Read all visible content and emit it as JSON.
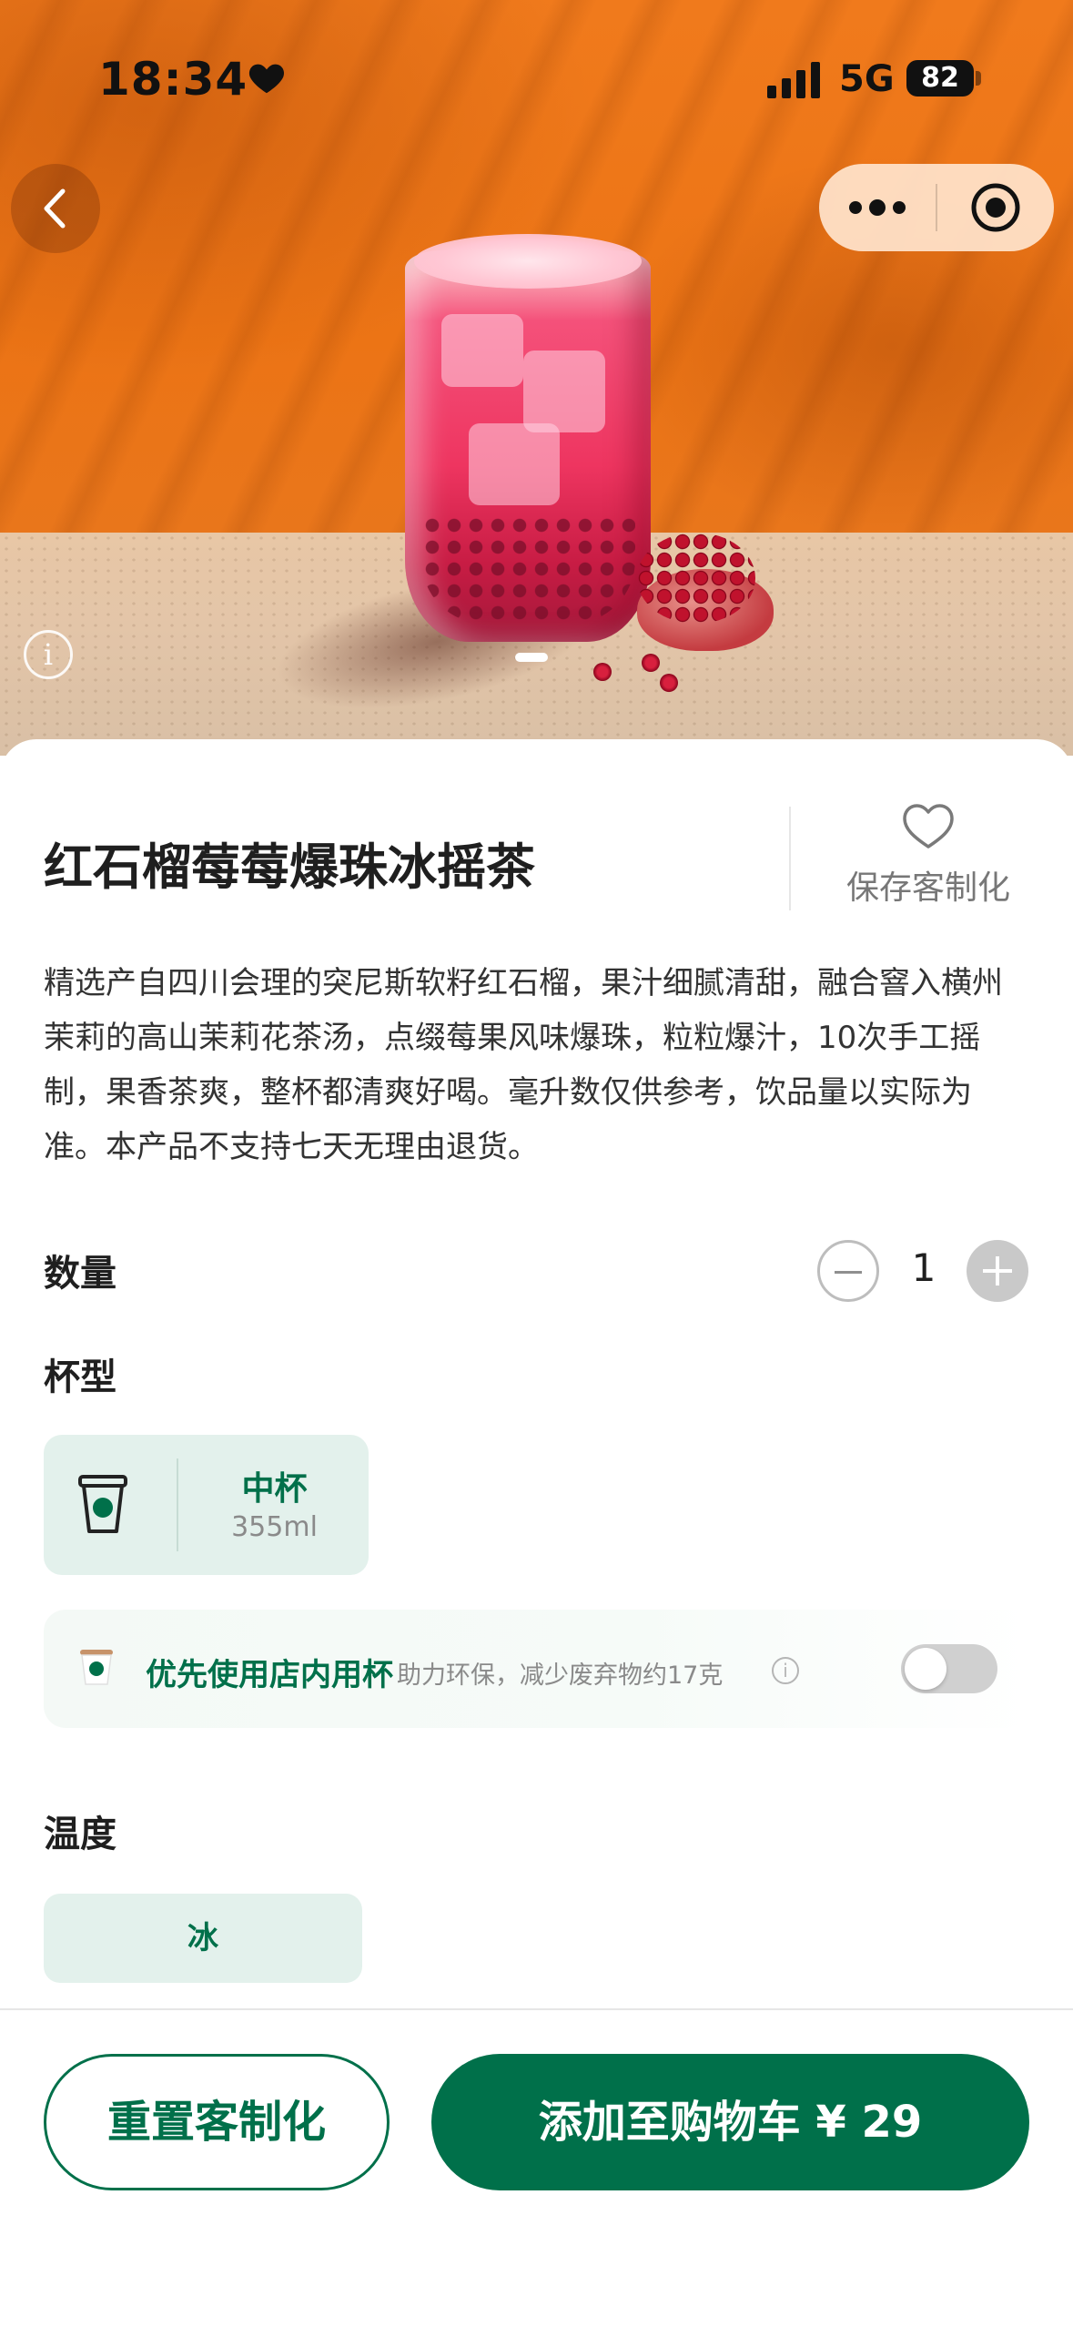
{
  "status_bar": {
    "time": "18:34",
    "network": "5G",
    "battery": "82"
  },
  "nav": {
    "back_icon": "chevron-left-icon",
    "more_icon": "more-dots-icon",
    "target_icon": "record-target-icon"
  },
  "hero": {
    "image_info_glyph": "i",
    "carousel_index": 1
  },
  "product": {
    "title": "红石榴莓莓爆珠冰摇茶",
    "save_custom_label": "保存客制化",
    "description": "精选产自四川会理的突尼斯软籽红石榴，果汁细腻清甜，融合窨入横州茉莉的高山茉莉花茶汤，点缀莓果风味爆珠，粒粒爆汁，10次手工摇制，果香茶爽，整杯都清爽好喝。毫升数仅供参考，饮品量以实际为准。本产品不支持七天无理由退货。"
  },
  "quantity": {
    "label": "数量",
    "value": "1"
  },
  "cup_size": {
    "label": "杯型",
    "options": [
      {
        "name": "中杯",
        "volume": "355ml",
        "selected": true
      }
    ]
  },
  "in_store_cup": {
    "primary": "优先使用店内用杯",
    "secondary": "助力环保，减少废弃物约17克",
    "info_glyph": "i",
    "enabled": false
  },
  "temperature": {
    "label": "温度",
    "options": [
      {
        "name": "冰",
        "selected": true
      }
    ]
  },
  "actions": {
    "reset_label": "重置客制化",
    "add_to_cart_label": "添加至购物车 ¥ 29"
  },
  "colors": {
    "brand_green": "#00704a",
    "option_bg": "#e3f1ec",
    "hero_orange": "#ec7415"
  }
}
